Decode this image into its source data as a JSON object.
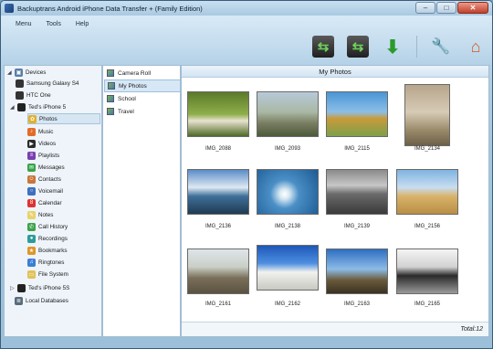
{
  "window": {
    "title": "Backuptrans Android iPhone Data Transfer + (Family Edition)"
  },
  "menu": [
    "Menu",
    "Tools",
    "Help"
  ],
  "toolbar": [
    {
      "name": "transfer-android-to-iphone",
      "icon": "phone-arrow"
    },
    {
      "name": "transfer-iphone-to-android",
      "icon": "phone-arrow"
    },
    {
      "name": "export",
      "icon": "download-arrow"
    },
    {
      "name": "tools",
      "icon": "wrench"
    },
    {
      "name": "home",
      "icon": "house"
    }
  ],
  "tree": {
    "devices_label": "Devices",
    "devices": [
      "Samsung Galaxy S4",
      "HTC One",
      "Ted's iPhone 5"
    ],
    "iphone_items": [
      "Photos",
      "Music",
      "Videos",
      "Playlists",
      "Messages",
      "Contacts",
      "Voicemail",
      "Calendar",
      "Notes",
      "Call History",
      "Recordings",
      "Bookmarks",
      "Ringtones",
      "File System"
    ],
    "other_device": "Ted's iPhone 5S",
    "local": "Local Databases"
  },
  "albums": [
    "Camera Roll",
    "My Photos",
    "School",
    "Travel"
  ],
  "selected_album": "My Photos",
  "photos_title": "My Photos",
  "photos": [
    "IMG_2088",
    "IMG_2093",
    "IMG_2115",
    "IMG_2134",
    "IMG_2136",
    "IMG_2138",
    "IMG_2139",
    "IMG_2156",
    "IMG_2161",
    "IMG_2162",
    "IMG_2163",
    "IMG_2165"
  ],
  "total": "Total:12"
}
